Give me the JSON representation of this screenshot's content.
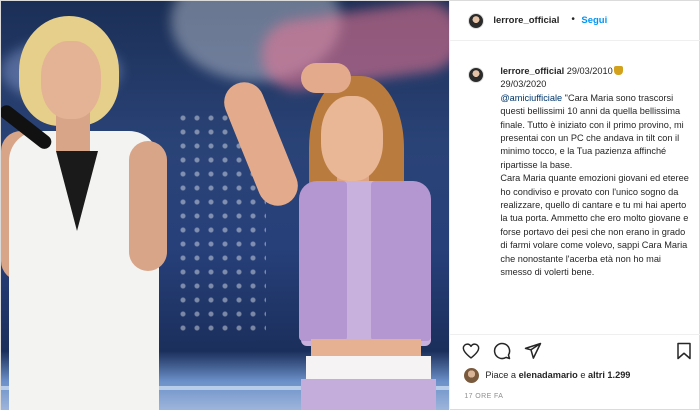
{
  "post": {
    "author": {
      "username": "lerrore_official",
      "separator": "•",
      "follow_label": "Segui"
    },
    "caption": {
      "date_prefix": "29/03/2010",
      "date_second": "29/03/2020",
      "mention": "@amiciufficiale",
      "body_1": " \"Cara Maria sono trascorsi questi bellissimi 10 anni da quella bellissima finale. Tutto è iniziato con il primo provino, mi presentai con un PC che andava in tilt con il minimo tocco, e la Tua pazienza affinché ripartisse la base.",
      "body_2": "Cara Maria quante emozioni giovani ed eteree ho condiviso e provato con l'unico sogno da realizzare, quello di cantare e tu mi hai aperto la tua porta. Ammetto che ero molto giovane e forse portavo dei pesi che non erano in grado di farmi volare come volevo, sappi Cara Maria che nonostante l'acerba età non ho mai smesso di volerti bene."
    },
    "actions": {
      "like_icon": "heart-icon",
      "comment_icon": "comment-icon",
      "share_icon": "paper-plane-icon",
      "save_icon": "bookmark-icon"
    },
    "likes": {
      "prefix": "Piace a ",
      "first_user": "elenadamario",
      "middle": " e ",
      "others": "altri 1.299"
    },
    "timestamp": "17 ORE FA"
  },
  "colors": {
    "link_blue": "#0095f6",
    "mention_blue": "#00376b",
    "muted": "#8e8e8e"
  }
}
